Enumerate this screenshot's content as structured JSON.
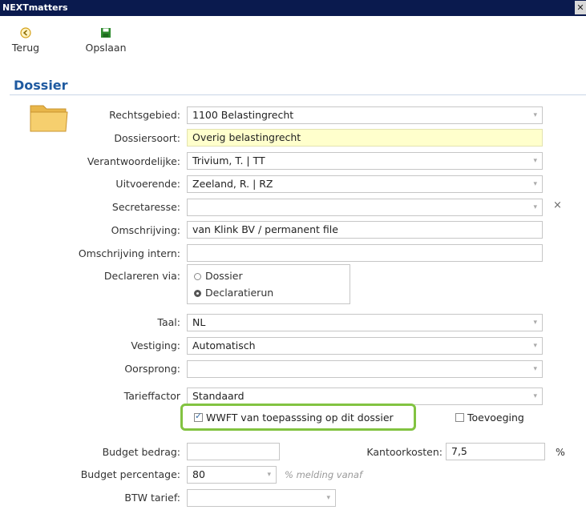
{
  "window": {
    "title": "NEXTmatters",
    "close": "✕"
  },
  "toolbar": {
    "back_label": "Terug",
    "save_label": "Opslaan"
  },
  "section": {
    "title": "Dossier"
  },
  "fields": {
    "rechtsgebied": {
      "label": "Rechtsgebied:",
      "value": "1100 Belastingrecht"
    },
    "dossiersoort": {
      "label": "Dossiersoort:",
      "value": "Overig belastingrecht"
    },
    "verantwoordelijke": {
      "label": "Verantwoordelijke:",
      "value": "Trivium, T.   | TT"
    },
    "uitvoerende": {
      "label": "Uitvoerende:",
      "value": "Zeeland, R.  | RZ"
    },
    "secretaresse": {
      "label": "Secretaresse:",
      "value": "",
      "clear": "×"
    },
    "omschrijving": {
      "label": "Omschrijving:",
      "value": "van Klink BV / permanent file"
    },
    "omschrijving_intern": {
      "label": "Omschrijving intern:",
      "value": ""
    },
    "declareren": {
      "label": "Declareren via:",
      "options": [
        "Dossier",
        "Declaratierun"
      ],
      "selected": "Declaratierun"
    },
    "taal": {
      "label": "Taal:",
      "value": "NL"
    },
    "vestiging": {
      "label": "Vestiging:",
      "value": "Automatisch"
    },
    "oorsprong": {
      "label": "Oorsprong:",
      "value": ""
    },
    "tarieffactor": {
      "label": "Tarieffactor",
      "value": "Standaard"
    },
    "wwft": {
      "label": "WWFT van toepasssing op dit dossier",
      "checked": true
    },
    "toevoeging": {
      "label": "Toevoeging",
      "checked": false
    },
    "budget_bedrag": {
      "label": "Budget bedrag:",
      "value": ""
    },
    "kantoorkosten": {
      "label": "Kantoorkosten:",
      "value": "7,5",
      "unit": "%"
    },
    "budget_percentage": {
      "label": "Budget percentage:",
      "value": "80",
      "hint": "% melding vanaf"
    },
    "btw_tarief": {
      "label": "BTW tarief:",
      "value": ""
    }
  },
  "colors": {
    "accent": "#1f5aa0",
    "highlight": "#82c341",
    "titlebar": "#0a1a4e",
    "yellow_field": "#ffffcc"
  }
}
